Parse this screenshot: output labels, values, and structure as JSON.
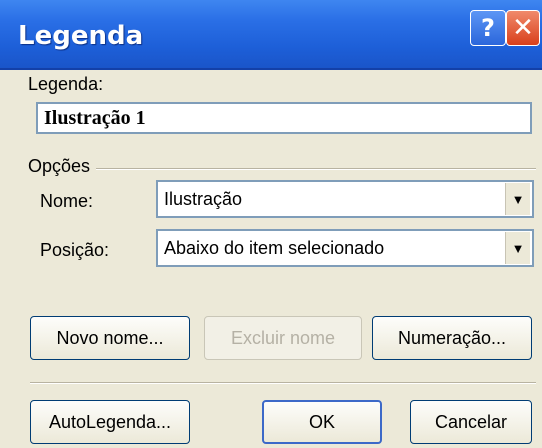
{
  "window": {
    "title": "Legenda",
    "help_glyph": "?",
    "close_glyph": "✕"
  },
  "caption": {
    "label": "Legenda:",
    "value": "Ilustração 1"
  },
  "options": {
    "group_label": "Opções",
    "name_label": "Nome:",
    "name_value": "Ilustração",
    "position_label": "Posição:",
    "position_value": "Abaixo do item selecionado"
  },
  "buttons": {
    "new_name": "Novo nome...",
    "delete_name": "Excluir nome",
    "numbering": "Numeração...",
    "autocaption": "AutoLegenda...",
    "ok": "OK",
    "cancel": "Cancelar"
  },
  "icons": {
    "dropdown": "▼"
  }
}
